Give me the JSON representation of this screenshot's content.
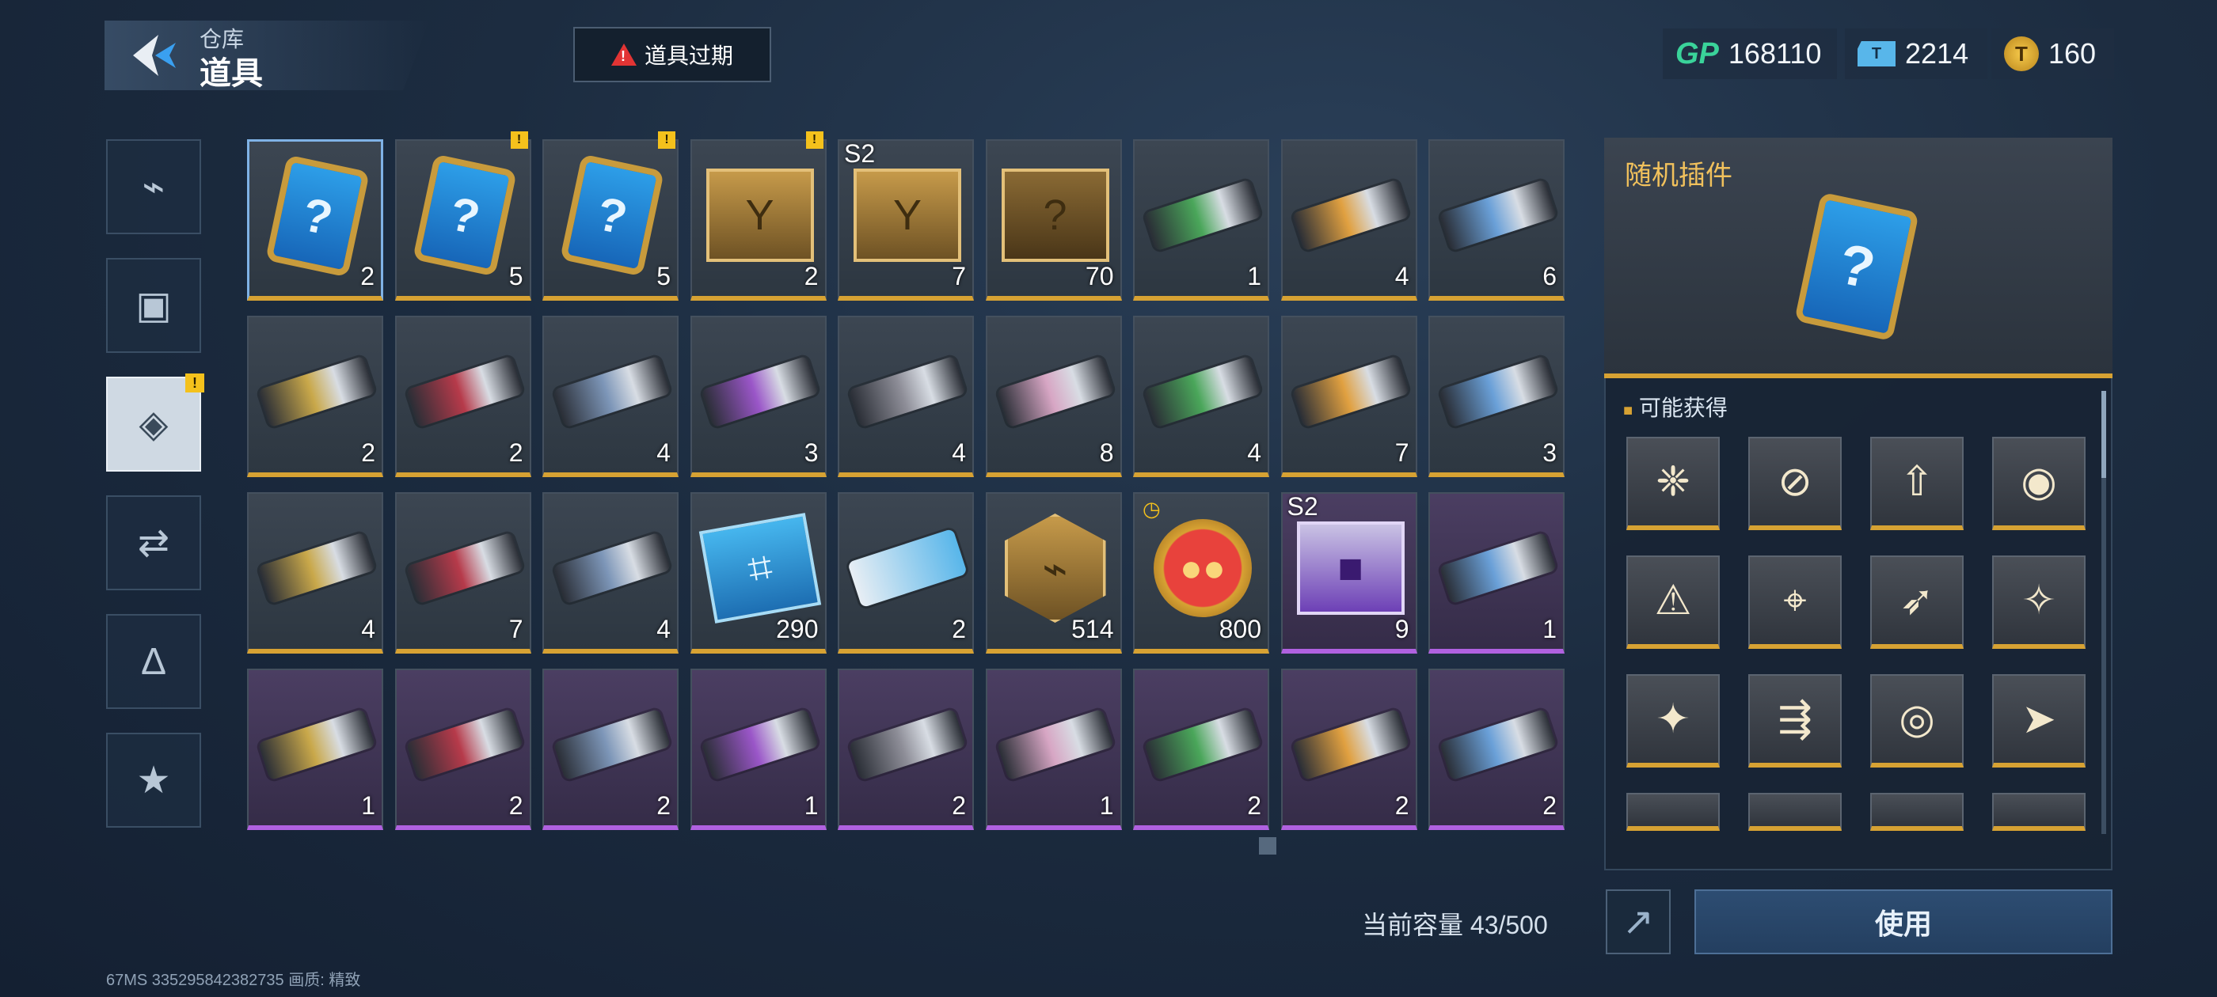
{
  "header": {
    "breadcrumb": "仓库",
    "title": "道具",
    "expire_label": "道具过期"
  },
  "currencies": [
    {
      "icon": "gp-icon",
      "label": "GP",
      "value": "168110"
    },
    {
      "icon": "ticket-icon",
      "value": "2214"
    },
    {
      "icon": "coin-icon",
      "value": "160"
    }
  ],
  "tabs": [
    {
      "icon": "pistol-icon"
    },
    {
      "icon": "frame-icon"
    },
    {
      "icon": "item-card-icon",
      "active": true,
      "badge": "!"
    },
    {
      "icon": "swap-icon"
    },
    {
      "icon": "compass-icon"
    },
    {
      "icon": "star-icon"
    }
  ],
  "grid": {
    "rows": [
      [
        {
          "name": "random-plugin-card",
          "qty": "2",
          "rarity": "gold",
          "selected": true
        },
        {
          "name": "random-plugin-card",
          "qty": "5",
          "rarity": "gold",
          "badge": "!"
        },
        {
          "name": "random-plugin-card",
          "qty": "5",
          "rarity": "gold",
          "badge": "!"
        },
        {
          "name": "gold-crate",
          "qty": "2",
          "rarity": "gold",
          "badge": "!"
        },
        {
          "name": "s2-crate",
          "qty": "7",
          "rarity": "gold",
          "tag": "S2"
        },
        {
          "name": "mystery-weapon-box",
          "qty": "70",
          "rarity": "gold"
        },
        {
          "name": "weapon-skin",
          "qty": "1",
          "rarity": "gold"
        },
        {
          "name": "weapon-skin",
          "qty": "4",
          "rarity": "gold"
        },
        {
          "name": "weapon-skin",
          "qty": "6",
          "rarity": "gold"
        }
      ],
      [
        {
          "name": "weapon-skin",
          "qty": "2",
          "rarity": "gold"
        },
        {
          "name": "weapon-skin",
          "qty": "2",
          "rarity": "gold"
        },
        {
          "name": "weapon-skin",
          "qty": "4",
          "rarity": "gold"
        },
        {
          "name": "weapon-skin",
          "qty": "3",
          "rarity": "gold"
        },
        {
          "name": "weapon-skin",
          "qty": "4",
          "rarity": "gold"
        },
        {
          "name": "weapon-skin",
          "qty": "8",
          "rarity": "gold"
        },
        {
          "name": "weapon-skin",
          "qty": "4",
          "rarity": "gold"
        },
        {
          "name": "weapon-skin",
          "qty": "7",
          "rarity": "gold"
        },
        {
          "name": "melee-skin",
          "qty": "3",
          "rarity": "gold"
        }
      ],
      [
        {
          "name": "weapon-skin",
          "qty": "4",
          "rarity": "gold"
        },
        {
          "name": "weapon-skin",
          "qty": "7",
          "rarity": "gold"
        },
        {
          "name": "weapon-skin",
          "qty": "4",
          "rarity": "gold"
        },
        {
          "name": "chip-card",
          "qty": "290",
          "rarity": "gold"
        },
        {
          "name": "ticket-card",
          "qty": "2",
          "rarity": "gold"
        },
        {
          "name": "weapon-medal",
          "qty": "514",
          "rarity": "gold"
        },
        {
          "name": "pig-token",
          "qty": "800",
          "rarity": "gold",
          "clock": true
        },
        {
          "name": "s2-purple-crate",
          "qty": "9",
          "rarity": "purple",
          "tag": "S2"
        },
        {
          "name": "weapon-skin",
          "qty": "1",
          "rarity": "purple"
        }
      ],
      [
        {
          "name": "weapon-skin",
          "qty": "1",
          "rarity": "purple"
        },
        {
          "name": "weapon-skin",
          "qty": "2",
          "rarity": "purple"
        },
        {
          "name": "weapon-skin",
          "qty": "2",
          "rarity": "purple"
        },
        {
          "name": "weapon-skin",
          "qty": "1",
          "rarity": "purple"
        },
        {
          "name": "weapon-skin",
          "qty": "2",
          "rarity": "purple"
        },
        {
          "name": "weapon-skin",
          "qty": "1",
          "rarity": "purple"
        },
        {
          "name": "weapon-skin",
          "qty": "2",
          "rarity": "purple"
        },
        {
          "name": "weapon-skin",
          "qty": "2",
          "rarity": "purple"
        },
        {
          "name": "weapon-skin",
          "qty": "2",
          "rarity": "purple"
        }
      ]
    ]
  },
  "detail": {
    "title": "随机插件",
    "possible_label": "可能获得",
    "rewards": [
      "plugin-icon",
      "plugin-icon",
      "plugin-icon",
      "plugin-icon",
      "plugin-icon",
      "plugin-icon",
      "plugin-icon",
      "plugin-icon",
      "plugin-icon",
      "plugin-icon",
      "plugin-icon",
      "plugin-icon"
    ]
  },
  "footer": {
    "capacity": "当前容量 43/500",
    "use_label": "使用",
    "status": "67MS   335295842382735      画质:  精致"
  },
  "colors": {
    "gold": "#d7a233",
    "purple": "#b061e0",
    "warn": "#e23434",
    "accent": "#f1c15c"
  }
}
